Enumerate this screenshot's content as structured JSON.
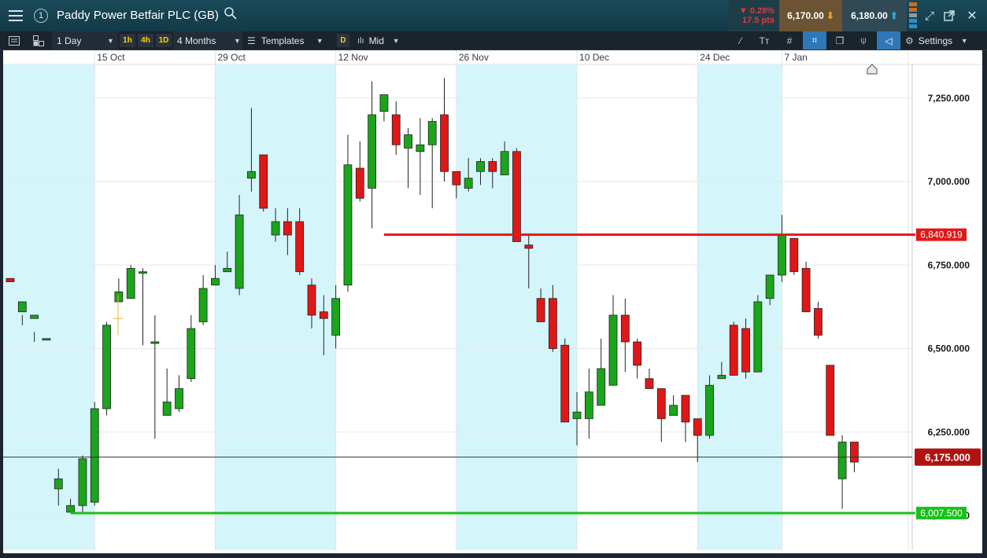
{
  "header": {
    "title": "Paddy Power Betfair PLC (GB)",
    "info_badge": "1",
    "change_pct": "▼ 0.28%",
    "change_pts": "17.5 pts",
    "sell_price": "6,170.00",
    "buy_price": "6,180.00"
  },
  "toolbar": {
    "interval": "1 Day",
    "quick_intervals": [
      "1h",
      "4h",
      "1D"
    ],
    "range": "4 Months",
    "templates": "Templates",
    "d_badge": "D",
    "price_type": "Mid",
    "settings": "Settings"
  },
  "chart_data": {
    "type": "candlestick",
    "x_labels": [
      {
        "label": "15 Oct",
        "index": 7
      },
      {
        "label": "29 Oct",
        "index": 17
      },
      {
        "label": "12 Nov",
        "index": 27
      },
      {
        "label": "26 Nov",
        "index": 37
      },
      {
        "label": "10 Dec",
        "index": 47
      },
      {
        "label": "24 Dec",
        "index": 57
      },
      {
        "label": "7 Jan",
        "index": 64
      }
    ],
    "y_ticks": [
      {
        "value": 7250,
        "label": "7,250.000"
      },
      {
        "value": 7000,
        "label": "7,000.000"
      },
      {
        "value": 6750,
        "label": "6,750.000"
      },
      {
        "value": 6500,
        "label": "6,500.000"
      },
      {
        "value": 6250,
        "label": "6,250.000"
      },
      {
        "value": 6000,
        "label": "6,000.000"
      }
    ],
    "ylim": [
      5850,
      7430
    ],
    "lines": [
      {
        "value": 6840.919,
        "label": "6,840.919",
        "color": "#e01818",
        "from_index": 31
      },
      {
        "value": 6007.5,
        "label": "6,007.500",
        "color": "#19c019",
        "from_index": 5
      }
    ],
    "current": {
      "value": 6175.0,
      "label": "6,175.000",
      "color": "#b01212"
    },
    "candles": [
      [
        6710,
        6700,
        6620,
        6620
      ],
      [
        6610,
        6640,
        6570,
        6600
      ],
      [
        6590,
        6600,
        6520,
        6550
      ],
      [
        6530,
        6530,
        6210,
        6210
      ],
      [
        6080,
        6110,
        6030,
        6140
      ],
      [
        6010,
        6030,
        6010,
        6050
      ],
      [
        6030,
        6170,
        6010,
        6180
      ],
      [
        6040,
        6320,
        6030,
        6340
      ],
      [
        6320,
        6570,
        6300,
        6580
      ],
      [
        6640,
        6670,
        6640,
        6710
      ],
      [
        6650,
        6740,
        6650,
        6750
      ],
      [
        6730,
        6730,
        6510,
        6740
      ],
      [
        6520,
        6520,
        6230,
        6600
      ],
      [
        6300,
        6340,
        6330,
        6440
      ],
      [
        6320,
        6380,
        6310,
        6420
      ],
      [
        6410,
        6560,
        6400,
        6600
      ],
      [
        6580,
        6680,
        6570,
        6720
      ],
      [
        6690,
        6710,
        6690,
        6750
      ],
      [
        6730,
        6740,
        6730,
        6790
      ],
      [
        6680,
        6900,
        6660,
        6960
      ],
      [
        7010,
        7030,
        6970,
        7220
      ],
      [
        7080,
        6920,
        6910,
        7080
      ],
      [
        6840,
        6880,
        6820,
        6920
      ],
      [
        6880,
        6840,
        6780,
        6920
      ],
      [
        6880,
        6730,
        6720,
        6920
      ],
      [
        6690,
        6600,
        6560,
        6710
      ],
      [
        6610,
        6590,
        6480,
        6660
      ],
      [
        6540,
        6650,
        6500,
        6690
      ],
      [
        6690,
        7050,
        6670,
        7140
      ],
      [
        7040,
        6950,
        6940,
        7120
      ],
      [
        6980,
        7200,
        6860,
        7300
      ],
      [
        7210,
        7260,
        7180,
        7260
      ],
      [
        7200,
        7110,
        7080,
        7240
      ],
      [
        7100,
        7140,
        6980,
        7160
      ],
      [
        7090,
        7110,
        6960,
        7190
      ],
      [
        7110,
        7180,
        6920,
        7190
      ],
      [
        7200,
        7030,
        7000,
        7310
      ],
      [
        7030,
        6990,
        6950,
        7030
      ],
      [
        6980,
        7010,
        6970,
        7070
      ],
      [
        7030,
        7060,
        6990,
        7070
      ],
      [
        7060,
        7030,
        6980,
        7070
      ],
      [
        7020,
        7090,
        7020,
        7120
      ],
      [
        7090,
        6820,
        6820,
        7100
      ],
      [
        6810,
        6800,
        6680,
        6840
      ],
      [
        6650,
        6580,
        6610,
        6680
      ],
      [
        6650,
        6500,
        6490,
        6690
      ],
      [
        6510,
        6280,
        6290,
        6530
      ],
      [
        6290,
        6310,
        6210,
        6370
      ],
      [
        6290,
        6370,
        6230,
        6440
      ],
      [
        6330,
        6440,
        6330,
        6530
      ],
      [
        6390,
        6600,
        6400,
        6660
      ],
      [
        6600,
        6520,
        6430,
        6650
      ],
      [
        6520,
        6450,
        6410,
        6530
      ],
      [
        6410,
        6380,
        6380,
        6440
      ],
      [
        6380,
        6290,
        6220,
        6380
      ],
      [
        6300,
        6330,
        6310,
        6360
      ],
      [
        6360,
        6280,
        6220,
        6330
      ],
      [
        6290,
        6240,
        6160,
        6280
      ],
      [
        6240,
        6390,
        6230,
        6420
      ],
      [
        6410,
        6420,
        6410,
        6460
      ],
      [
        6570,
        6420,
        6440,
        6580
      ],
      [
        6560,
        6430,
        6410,
        6590
      ],
      [
        6430,
        6640,
        6440,
        6660
      ],
      [
        6650,
        6720,
        6630,
        6720
      ],
      [
        6720,
        6840,
        6700,
        6900
      ],
      [
        6830,
        6730,
        6720,
        6830
      ],
      [
        6740,
        6610,
        6610,
        6760
      ],
      [
        6620,
        6540,
        6530,
        6640
      ],
      [
        6450,
        6240,
        6240,
        6450
      ],
      [
        6110,
        6220,
        6020,
        6240
      ],
      [
        6220,
        6160,
        6130,
        6220
      ]
    ]
  }
}
